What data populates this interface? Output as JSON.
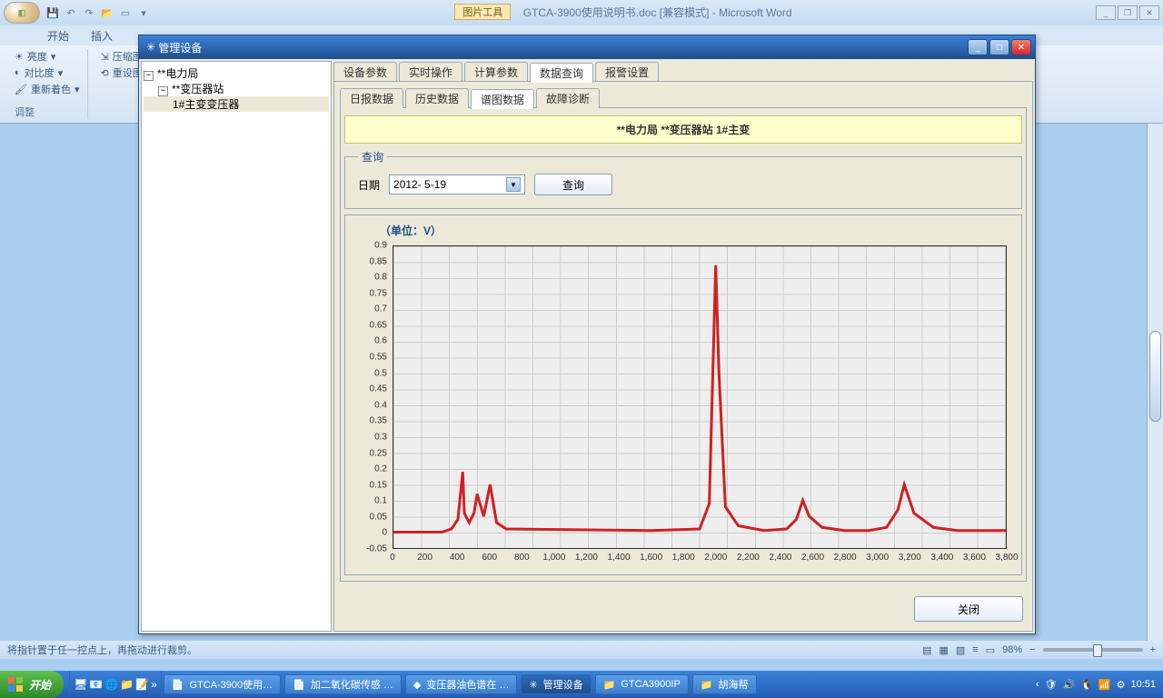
{
  "word": {
    "tool_tab": "图片工具",
    "title": "GTCA-3900使用说明书.doc [兼容模式] - Microsoft Word",
    "tabs": {
      "start": "开始",
      "insert": "插入"
    },
    "ribbon": {
      "brightness": "亮度",
      "contrast": "对比度",
      "recolor": "重新着色",
      "compress": "压缩图",
      "reset": "重设图",
      "group_adjust": "调整"
    },
    "status": "将指针置于任一控点上，再拖动进行裁剪。",
    "zoom": "98%"
  },
  "dialog": {
    "title": "管理设备",
    "tree": {
      "root": "**电力局",
      "station": "**变压器站",
      "device": "1#主变变压器"
    },
    "tabs1": {
      "a": "设备参数",
      "b": "实时操作",
      "c": "计算参数",
      "d": "数据查询",
      "e": "报警设置"
    },
    "tabs2": {
      "a": "日报数据",
      "b": "历史数据",
      "c": "谱图数据",
      "d": "故障诊断"
    },
    "header": "**电力局  **变压器站  1#主变",
    "query": {
      "legend": "查询",
      "date_label": "日期",
      "date_value": "2012- 5-19",
      "btn": "查询"
    },
    "chart_title": "（单位：V）",
    "close_btn": "关闭"
  },
  "taskbar": {
    "start": "开始",
    "items": [
      "GTCA-3900使用…",
      "加二氧化碳传感 …",
      "变压器油色谱在 …",
      "管理设备",
      "GTCA3900IP",
      "胡海帮"
    ],
    "clock": "10:51"
  },
  "chart_data": {
    "type": "line",
    "title": "（单位：V）",
    "xlabel": "",
    "ylabel": "",
    "xlim": [
      0,
      3800
    ],
    "ylim": [
      -0.05,
      0.9
    ],
    "y_ticks": [
      -0.05,
      0,
      0.05,
      0.1,
      0.15,
      0.2,
      0.25,
      0.3,
      0.35,
      0.4,
      0.45,
      0.5,
      0.55,
      0.6,
      0.65,
      0.7,
      0.75,
      0.8,
      0.85,
      0.9
    ],
    "x_ticks": [
      0,
      200,
      400,
      600,
      800,
      1000,
      1200,
      1400,
      1600,
      1800,
      2000,
      2200,
      2400,
      2600,
      2800,
      3000,
      3200,
      3400,
      3600,
      3800
    ],
    "x_tick_labels": [
      "0",
      "200",
      "400",
      "600",
      "800",
      "1,000",
      "1,200",
      "1,400",
      "1,600",
      "1,800",
      "2,000",
      "2,200",
      "2,400",
      "2,600",
      "2,800",
      "3,000",
      "3,200",
      "3,400",
      "3,600",
      "3,800"
    ],
    "series": [
      {
        "name": "V",
        "color": "#d02020",
        "x": [
          0,
          300,
          360,
          400,
          430,
          440,
          470,
          500,
          520,
          560,
          600,
          640,
          700,
          1600,
          1900,
          1960,
          2000,
          2020,
          2060,
          2140,
          2300,
          2440,
          2500,
          2540,
          2580,
          2660,
          2800,
          2950,
          3060,
          3130,
          3170,
          3230,
          3350,
          3500,
          3800
        ],
        "y": [
          0,
          0,
          0.01,
          0.04,
          0.19,
          0.06,
          0.03,
          0.06,
          0.12,
          0.05,
          0.15,
          0.03,
          0.01,
          0.005,
          0.01,
          0.09,
          0.84,
          0.5,
          0.08,
          0.02,
          0.005,
          0.01,
          0.04,
          0.1,
          0.05,
          0.015,
          0.005,
          0.005,
          0.015,
          0.07,
          0.15,
          0.06,
          0.015,
          0.005,
          0.005
        ]
      }
    ]
  }
}
